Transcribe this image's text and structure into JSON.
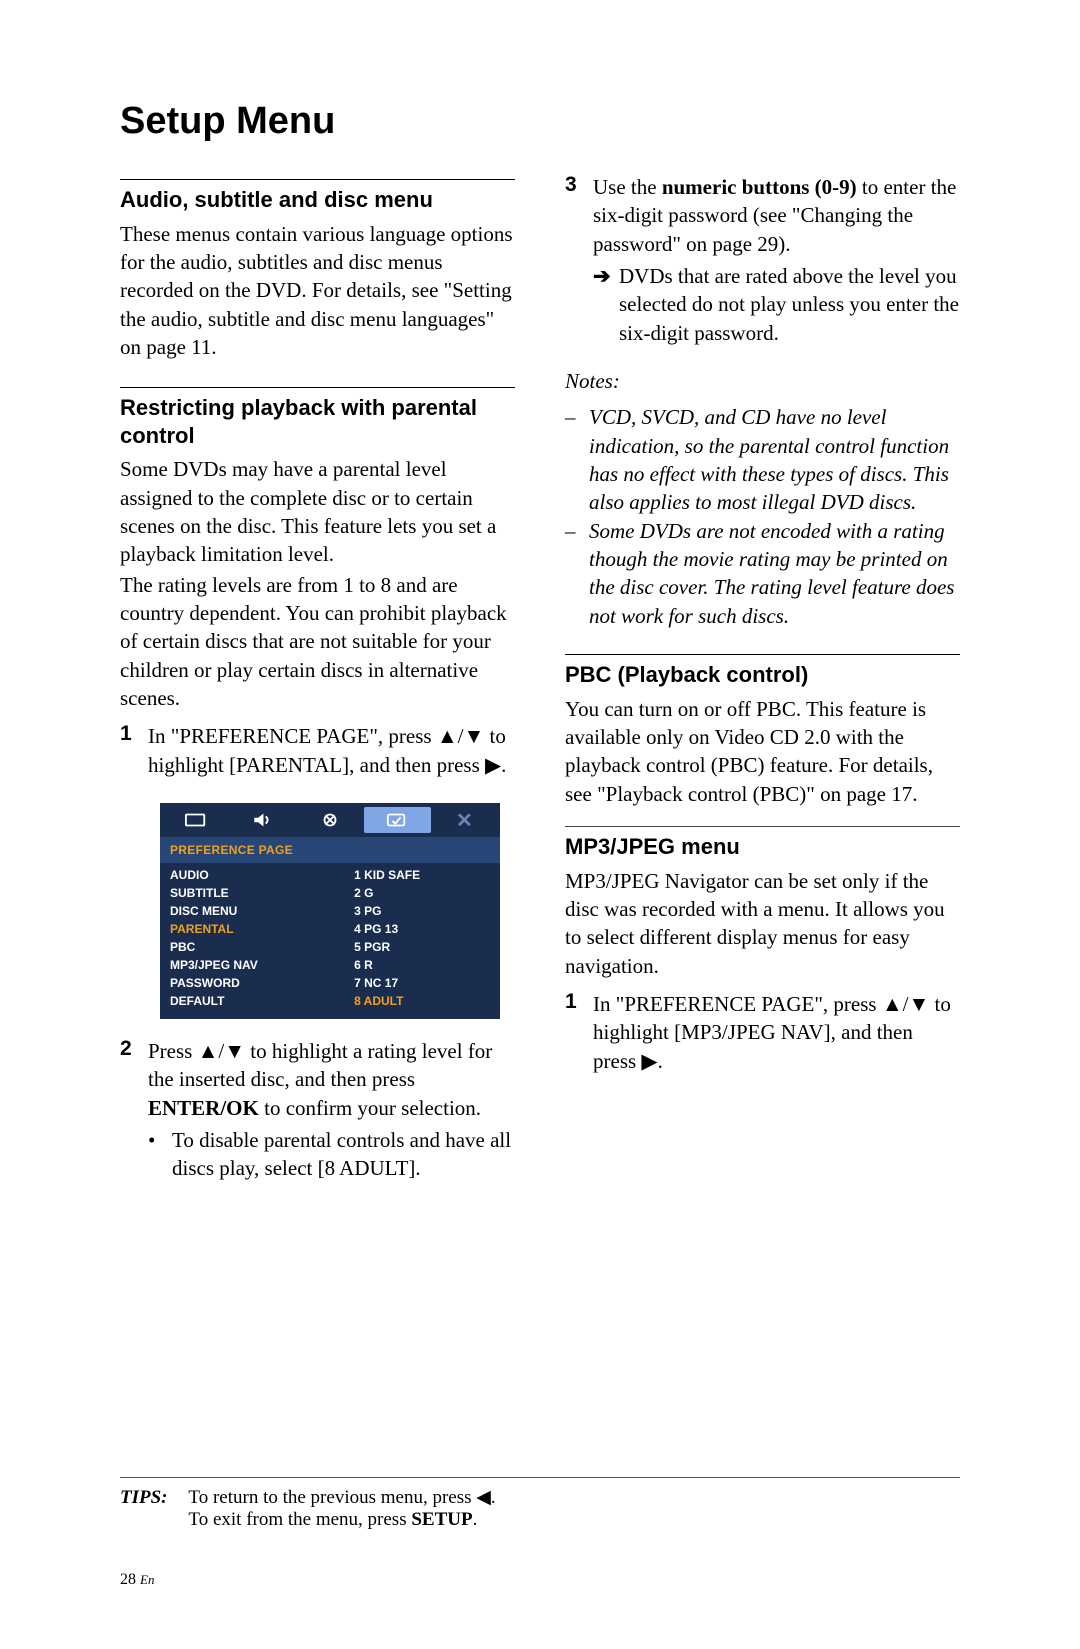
{
  "page_title": "Setup Menu",
  "left": {
    "sec1": {
      "heading": "Audio, subtitle and disc menu",
      "para": "These menus contain various language options for the audio, subtitles and disc menus recorded on the DVD. For details, see \"Setting the audio, subtitle and disc menu languages\" on page 11."
    },
    "sec2": {
      "heading": "Restricting playback with parental control",
      "para1": "Some DVDs may have a parental level assigned to the complete disc or to certain scenes on the disc. This feature lets you set a playback limitation level.",
      "para2": "The rating levels are from 1 to 8 and are country dependent. You can prohibit playback of certain discs that are not suitable for your children or play certain discs in alternative scenes.",
      "step1_a": "In \"PREFERENCE PAGE\", press ",
      "step1_b": " to highlight [PARENTAL], and then press ",
      "step1_c": ".",
      "step2_a": "Press ",
      "step2_b": " to highlight a rating level for the inserted disc, and then press ",
      "step2_c": "ENTER/OK",
      "step2_d": " to confirm your selection.",
      "step2_bullet": "To disable parental controls and have all discs play, select [8 ADULT]."
    }
  },
  "right": {
    "step3_a": "Use the ",
    "step3_b": "numeric buttons (0-9)",
    "step3_c": " to enter the six-digit password (see \"Changing the password\" on page 29).",
    "step3_arrow": "DVDs that are rated above the level you selected do not play unless you enter the six-digit password.",
    "notes_label": "Notes:",
    "note1": "VCD, SVCD, and CD have no level indication, so the parental control function has no effect with these types of discs. This also applies to most illegal DVD discs.",
    "note2": "Some DVDs are not encoded with a rating though the movie rating may be printed on the disc cover. The rating level feature does not work for such discs.",
    "pbc": {
      "heading": "PBC (Playback control)",
      "para": "You can turn on or off PBC. This feature is available only on Video CD 2.0 with the playback control (PBC) feature. For details, see \"Playback control (PBC)\" on page 17."
    },
    "mp3": {
      "heading": "MP3/JPEG menu",
      "para": "MP3/JPEG Navigator can be set only if the disc was recorded with a menu. It allows you to select different display menus for easy navigation.",
      "step1_a": "In \"PREFERENCE PAGE\", press ",
      "step1_b": " to highlight [MP3/JPEG NAV], and then press ",
      "step1_c": "."
    }
  },
  "osd": {
    "title": "PREFERENCE PAGE",
    "left_items": [
      "AUDIO",
      "SUBTITLE",
      "DISC MENU",
      "PARENTAL",
      "PBC",
      "MP3/JPEG NAV",
      "PASSWORD",
      "DEFAULT"
    ],
    "left_highlight_index": 3,
    "right_items": [
      "1 KID SAFE",
      "2 G",
      "3 PG",
      "4 PG 13",
      "5 PGR",
      "6 R",
      "7 NC 17",
      "8 ADULT"
    ],
    "right_highlight_index": 7
  },
  "tips": {
    "label": "TIPS:",
    "line1_a": "To return to the previous menu, press ",
    "line1_b": ".",
    "line2_a": "To exit from the menu, press ",
    "line2_b": "SETUP",
    "line2_c": "."
  },
  "footer": {
    "page_num": "28",
    "lang": "En"
  },
  "glyphs": {
    "up": "▲",
    "down": "▼",
    "right": "▶",
    "left": "◀",
    "slash": "/",
    "rarrow": "➔",
    "dot": "•",
    "dash": "–"
  }
}
